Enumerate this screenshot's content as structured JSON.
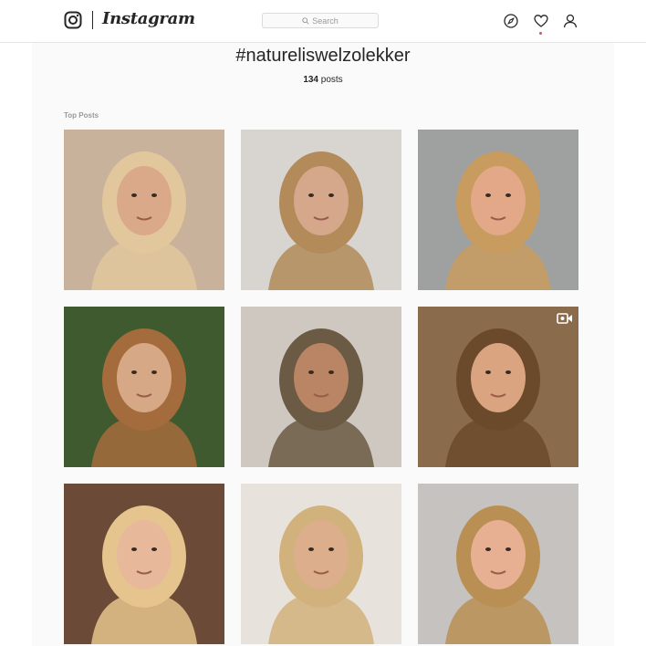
{
  "header": {
    "brand": "Instagram",
    "search_placeholder": "Search"
  },
  "hashtag_page": {
    "title": "#natureliswelzolekker",
    "post_count": "134",
    "post_count_label": "posts",
    "section_label": "Top Posts"
  },
  "posts": [
    {
      "id": "post-1",
      "colors": {
        "bg": "#c9b29c",
        "hair": "#e2c79c",
        "skin": "#d9a98a"
      }
    },
    {
      "id": "post-2",
      "colors": {
        "bg": "#d8d4cf",
        "hair": "#b38b5a",
        "skin": "#d6a88b"
      }
    },
    {
      "id": "post-3",
      "colors": {
        "bg": "#9fa1a0",
        "hair": "#c89b5f",
        "skin": "#e2a887"
      }
    },
    {
      "id": "post-4",
      "colors": {
        "bg": "#3e5a2e",
        "hair": "#a46c3c",
        "skin": "#d6a886"
      }
    },
    {
      "id": "post-5",
      "colors": {
        "bg": "#cfc8c0",
        "hair": "#6b5a44",
        "skin": "#b98564"
      }
    },
    {
      "id": "post-6",
      "colors": {
        "bg": "#8a6b4c",
        "hair": "#6b4a2c",
        "skin": "#d9a47f"
      }
    },
    {
      "id": "post-7",
      "colors": {
        "bg": "#6b4a38",
        "hair": "#e6c48d",
        "skin": "#e8b89b"
      }
    },
    {
      "id": "post-8",
      "colors": {
        "bg": "#e7e3dc",
        "hair": "#d2b27c",
        "skin": "#dcae8c"
      }
    },
    {
      "id": "post-9",
      "colors": {
        "bg": "#c5c2c0",
        "hair": "#b98f54",
        "skin": "#e7b093"
      }
    }
  ],
  "video_badge_icon": "video-camera-icon"
}
